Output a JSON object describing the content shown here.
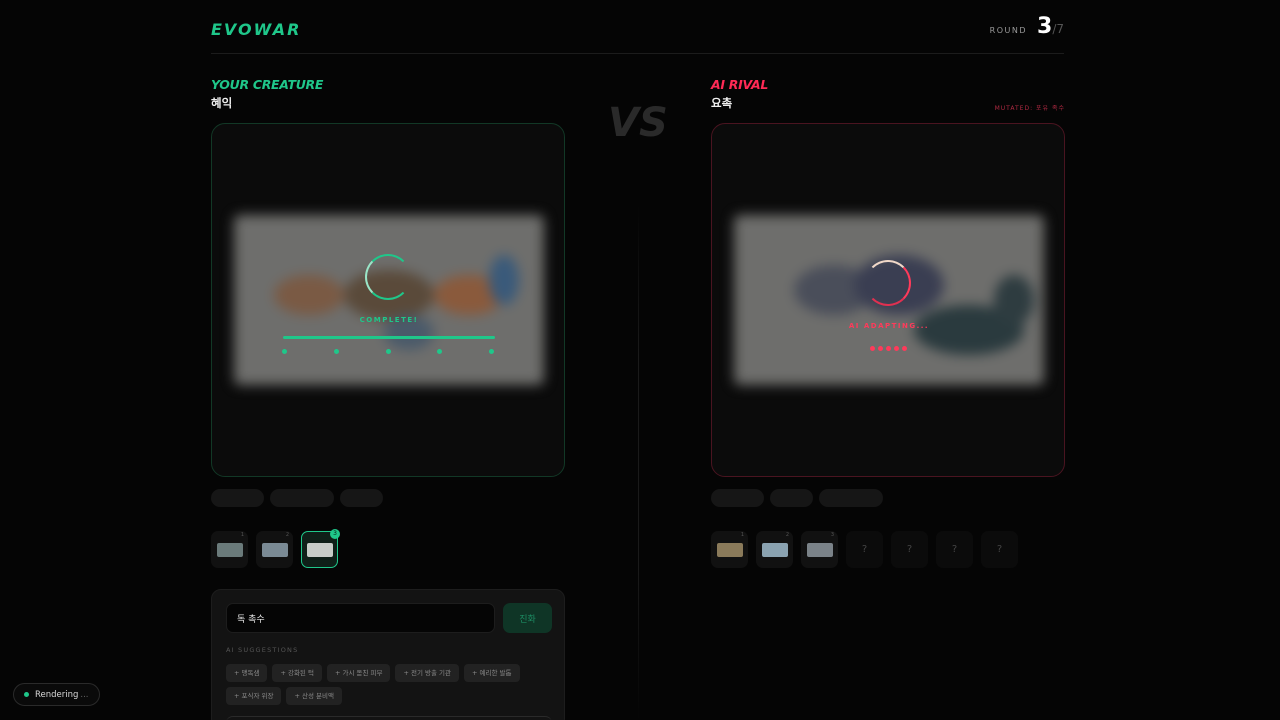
{
  "header": {
    "logo": "EVOWAR",
    "round_label": "ROUND",
    "round_current": "3",
    "round_total": "/7"
  },
  "vs_label": "VS",
  "player": {
    "side_title": "YOUR CREATURE",
    "creature_name": "혜익",
    "status": "COMPLETE!",
    "progress": 1.0,
    "history": [
      {
        "num": "1"
      },
      {
        "num": "2"
      },
      {
        "num": "3",
        "active": true
      }
    ]
  },
  "rival": {
    "side_title": "AI RIVAL",
    "creature_name": "요촉",
    "mutated_label": "MUTATED: 포유 족수",
    "status": "AI ADAPTING...",
    "history": [
      {
        "num": "1"
      },
      {
        "num": "2"
      },
      {
        "num": "3"
      }
    ],
    "unknown_slots": [
      "?",
      "?",
      "?",
      "?"
    ]
  },
  "evolve": {
    "input_value": "독 촉수",
    "button_label": "진화",
    "suggestions_label": "AI SUGGESTIONS",
    "suggestions": [
      "+ 맹독샘",
      "+ 강화된 턱",
      "+ 가시 돋친 피부",
      "+ 전기 방출 기관",
      "+ 예리한 발톱",
      "+ 포식자 위장",
      "+ 산성 분비액"
    ]
  },
  "render_status": {
    "label": "Rendering",
    "ellipsis": "..."
  },
  "colors": {
    "player_accent": "#1fc78a",
    "rival_accent": "#ff2a55",
    "background": "#050505"
  }
}
